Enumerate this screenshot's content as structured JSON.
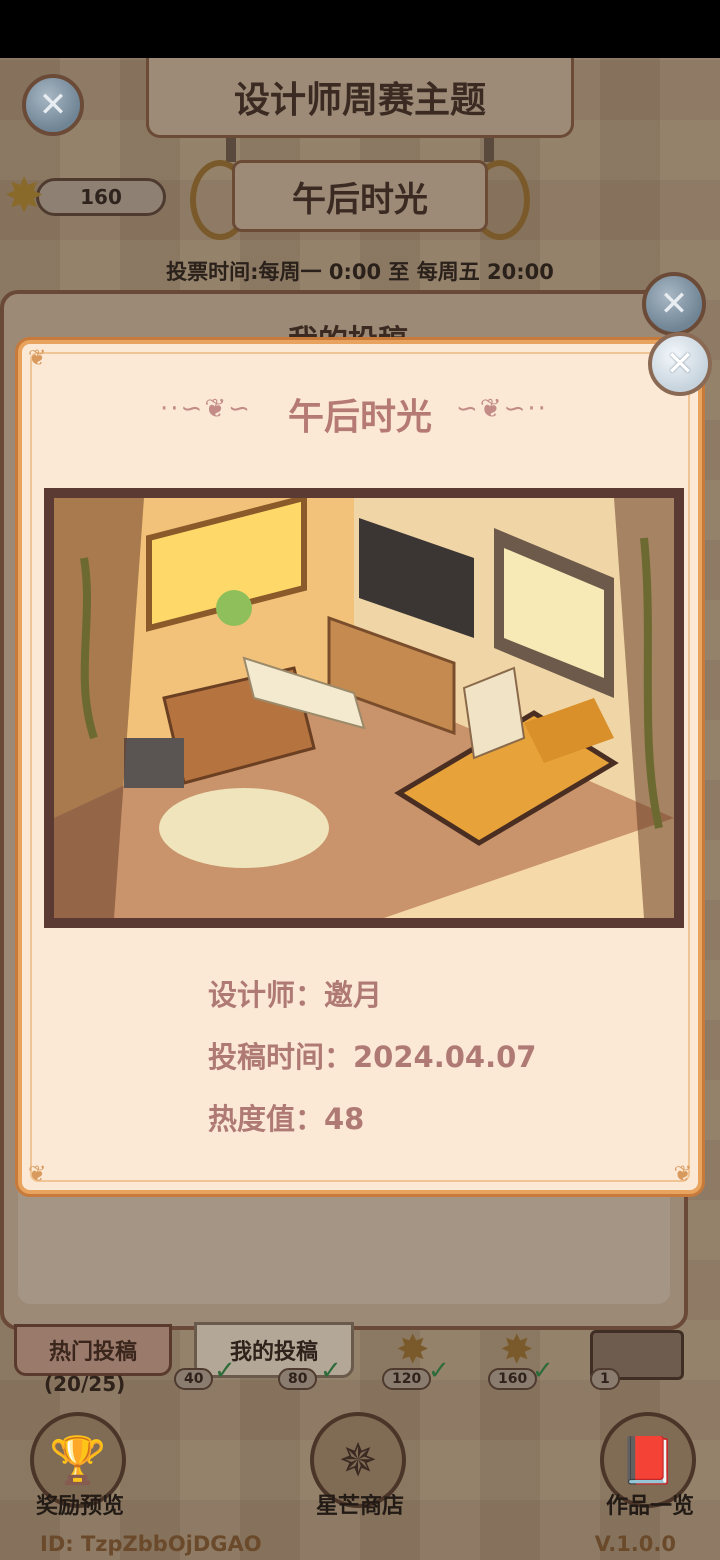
{
  "background": {
    "header_title": "设计师周赛主题",
    "theme_name": "午后时光",
    "star_count": "160",
    "vote_time": "投票时间:每周一  0:00  至  每周五  20:00",
    "panel_title": "我的投稿",
    "tabs": [
      {
        "label": "热门投稿"
      },
      {
        "label": "我的投稿"
      }
    ],
    "progress": "(20/25)",
    "milestones": [
      "40",
      "80",
      "120",
      "160",
      "1"
    ],
    "nav": [
      {
        "label": "奖励预览"
      },
      {
        "label": "星芒商店"
      },
      {
        "label": "作品一览"
      }
    ],
    "footer_id": "ID:  TzpZbbOjDGAO",
    "version": "V.1.0.0"
  },
  "dialog": {
    "title": "午后时光",
    "designer_line": "设计师：邀月",
    "submit_time_line": "投稿时间：2024.04.07",
    "heat_line": "热度值：48"
  },
  "icons": {
    "close": "close-icon",
    "star": "star-icon",
    "check": "check-icon"
  },
  "colors": {
    "dialog_bg": "#fbe9d6",
    "dialog_border": "#e8a35f",
    "title_text": "#b57a74",
    "frame": "#5b3a33"
  }
}
